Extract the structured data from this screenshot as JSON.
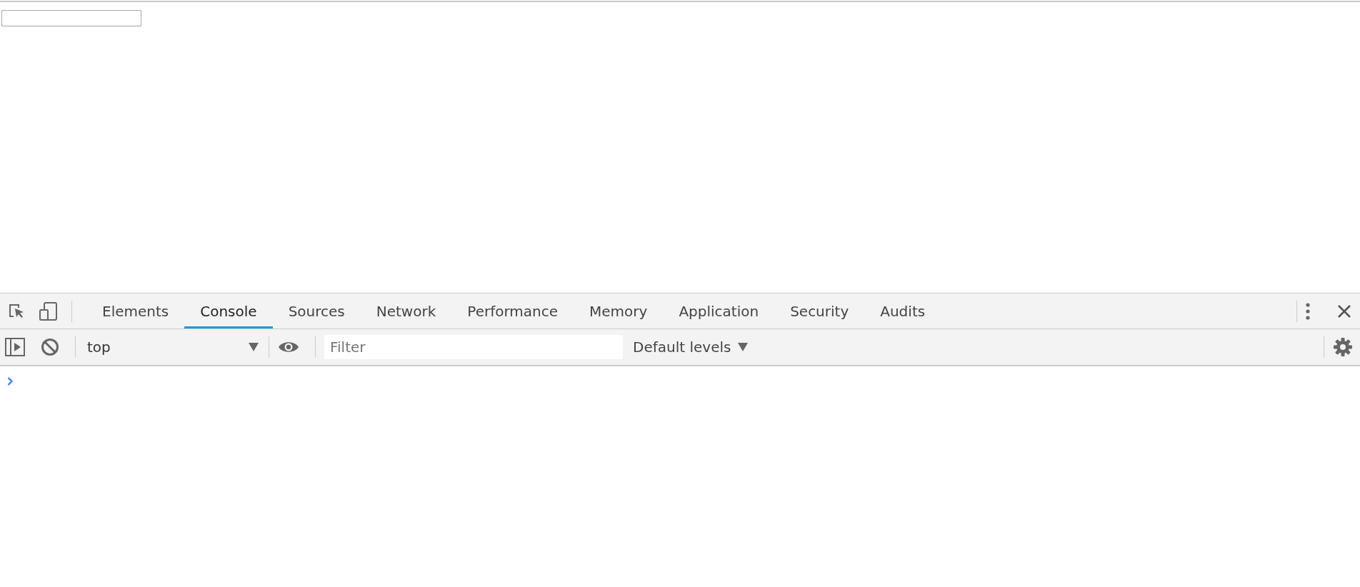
{
  "devtools": {
    "tabs": [
      {
        "label": "Elements",
        "selected": false
      },
      {
        "label": "Console",
        "selected": true
      },
      {
        "label": "Sources",
        "selected": false
      },
      {
        "label": "Network",
        "selected": false
      },
      {
        "label": "Performance",
        "selected": false
      },
      {
        "label": "Memory",
        "selected": false
      },
      {
        "label": "Application",
        "selected": false
      },
      {
        "label": "Security",
        "selected": false
      },
      {
        "label": "Audits",
        "selected": false
      }
    ],
    "console_toolbar": {
      "context": "top",
      "filter": {
        "placeholder": "Filter"
      },
      "levels": "Default levels"
    }
  }
}
